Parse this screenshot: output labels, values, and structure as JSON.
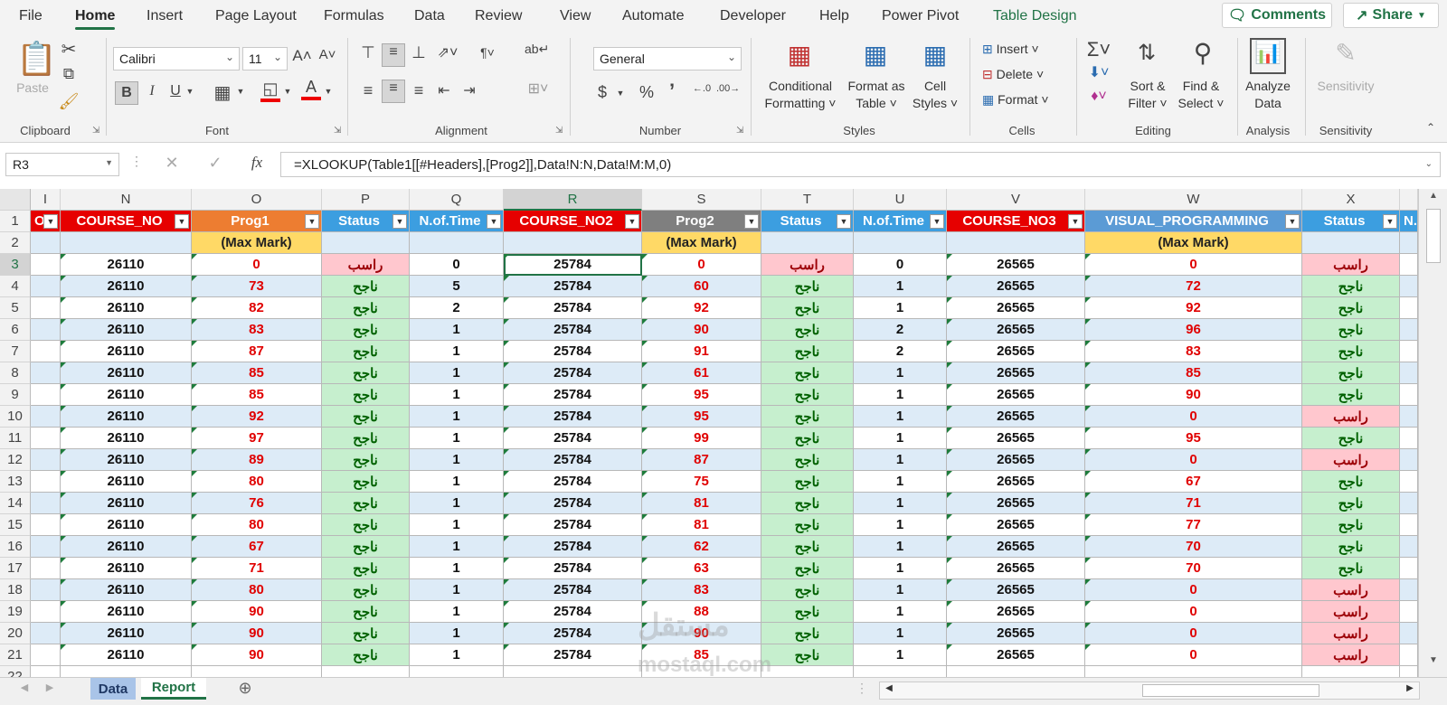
{
  "menu": {
    "tabs": [
      "File",
      "Home",
      "Insert",
      "Page Layout",
      "Formulas",
      "Data",
      "Review",
      "View",
      "Automate",
      "Developer",
      "Help",
      "Power Pivot",
      "Table Design"
    ],
    "comments": "Comments",
    "share": "Share"
  },
  "ribbon": {
    "clipboard": {
      "paste": "Paste",
      "label": "Clipboard"
    },
    "font": {
      "name": "Calibri",
      "size": "11",
      "label": "Font",
      "bold": "B",
      "italic": "I",
      "underline": "U"
    },
    "alignment": {
      "label": "Alignment"
    },
    "number": {
      "format": "General",
      "label": "Number",
      "currency": "$",
      "percent": "%"
    },
    "styles": {
      "conditional": [
        "Conditional",
        "Formatting"
      ],
      "format_table": [
        "Format as",
        "Table"
      ],
      "cell_styles": [
        "Cell",
        "Styles"
      ],
      "label": "Styles"
    },
    "cells": {
      "insert": "Insert",
      "delete": "Delete",
      "format": "Format",
      "label": "Cells"
    },
    "editing": {
      "sort": [
        "Sort &",
        "Filter"
      ],
      "find": [
        "Find &",
        "Select"
      ],
      "label": "Editing"
    },
    "analysis": {
      "analyze": [
        "Analyze",
        "Data"
      ],
      "label": "Analysis"
    },
    "sensitivity": {
      "button": "Sensitivity",
      "label": "Sensitivity"
    }
  },
  "formula_bar": {
    "name_box": "R3",
    "fx": "fx",
    "formula": "=XLOOKUP(Table1[[#Headers],[Prog2]],Data!N:N,Data!M:M,0)"
  },
  "grid": {
    "columns": [
      "I",
      "N",
      "O",
      "P",
      "Q",
      "R",
      "S",
      "T",
      "U",
      "V",
      "W",
      "X",
      ""
    ],
    "selected_column": "R",
    "headers": [
      "OB",
      "COURSE_NO",
      "Prog1",
      "Status",
      "N.of.Time",
      "COURSE_NO2",
      "Prog2",
      "Status",
      "N.of.Time",
      "COURSE_NO3",
      "VISUAL_PROGRAMMING",
      "Status",
      "N.o"
    ],
    "max_mark": "(Max Mark)",
    "rows": [
      {
        "r": "3",
        "n": "26110",
        "o": "0",
        "p": "راسب",
        "q": "0",
        "rr": "25784",
        "s": "0",
        "t": "راسب",
        "u": "0",
        "v": "26565",
        "w": "0",
        "x": "راسب"
      },
      {
        "r": "4",
        "n": "26110",
        "o": "73",
        "p": "ناجح",
        "q": "5",
        "rr": "25784",
        "s": "60",
        "t": "ناجح",
        "u": "1",
        "v": "26565",
        "w": "72",
        "x": "ناجح"
      },
      {
        "r": "5",
        "n": "26110",
        "o": "82",
        "p": "ناجح",
        "q": "2",
        "rr": "25784",
        "s": "92",
        "t": "ناجح",
        "u": "1",
        "v": "26565",
        "w": "92",
        "x": "ناجح"
      },
      {
        "r": "6",
        "n": "26110",
        "o": "83",
        "p": "ناجح",
        "q": "1",
        "rr": "25784",
        "s": "90",
        "t": "ناجح",
        "u": "2",
        "v": "26565",
        "w": "96",
        "x": "ناجح"
      },
      {
        "r": "7",
        "n": "26110",
        "o": "87",
        "p": "ناجح",
        "q": "1",
        "rr": "25784",
        "s": "91",
        "t": "ناجح",
        "u": "2",
        "v": "26565",
        "w": "83",
        "x": "ناجح"
      },
      {
        "r": "8",
        "n": "26110",
        "o": "85",
        "p": "ناجح",
        "q": "1",
        "rr": "25784",
        "s": "61",
        "t": "ناجح",
        "u": "1",
        "v": "26565",
        "w": "85",
        "x": "ناجح"
      },
      {
        "r": "9",
        "n": "26110",
        "o": "85",
        "p": "ناجح",
        "q": "1",
        "rr": "25784",
        "s": "95",
        "t": "ناجح",
        "u": "1",
        "v": "26565",
        "w": "90",
        "x": "ناجح"
      },
      {
        "r": "10",
        "n": "26110",
        "o": "92",
        "p": "ناجح",
        "q": "1",
        "rr": "25784",
        "s": "95",
        "t": "ناجح",
        "u": "1",
        "v": "26565",
        "w": "0",
        "x": "راسب"
      },
      {
        "r": "11",
        "n": "26110",
        "o": "97",
        "p": "ناجح",
        "q": "1",
        "rr": "25784",
        "s": "99",
        "t": "ناجح",
        "u": "1",
        "v": "26565",
        "w": "95",
        "x": "ناجح"
      },
      {
        "r": "12",
        "n": "26110",
        "o": "89",
        "p": "ناجح",
        "q": "1",
        "rr": "25784",
        "s": "87",
        "t": "ناجح",
        "u": "1",
        "v": "26565",
        "w": "0",
        "x": "راسب"
      },
      {
        "r": "13",
        "n": "26110",
        "o": "80",
        "p": "ناجح",
        "q": "1",
        "rr": "25784",
        "s": "75",
        "t": "ناجح",
        "u": "1",
        "v": "26565",
        "w": "67",
        "x": "ناجح"
      },
      {
        "r": "14",
        "n": "26110",
        "o": "76",
        "p": "ناجح",
        "q": "1",
        "rr": "25784",
        "s": "81",
        "t": "ناجح",
        "u": "1",
        "v": "26565",
        "w": "71",
        "x": "ناجح"
      },
      {
        "r": "15",
        "n": "26110",
        "o": "80",
        "p": "ناجح",
        "q": "1",
        "rr": "25784",
        "s": "81",
        "t": "ناجح",
        "u": "1",
        "v": "26565",
        "w": "77",
        "x": "ناجح"
      },
      {
        "r": "16",
        "n": "26110",
        "o": "67",
        "p": "ناجح",
        "q": "1",
        "rr": "25784",
        "s": "62",
        "t": "ناجح",
        "u": "1",
        "v": "26565",
        "w": "70",
        "x": "ناجح"
      },
      {
        "r": "17",
        "n": "26110",
        "o": "71",
        "p": "ناجح",
        "q": "1",
        "rr": "25784",
        "s": "63",
        "t": "ناجح",
        "u": "1",
        "v": "26565",
        "w": "70",
        "x": "ناجح"
      },
      {
        "r": "18",
        "n": "26110",
        "o": "80",
        "p": "ناجح",
        "q": "1",
        "rr": "25784",
        "s": "83",
        "t": "ناجح",
        "u": "1",
        "v": "26565",
        "w": "0",
        "x": "راسب"
      },
      {
        "r": "19",
        "n": "26110",
        "o": "90",
        "p": "ناجح",
        "q": "1",
        "rr": "25784",
        "s": "88",
        "t": "ناجح",
        "u": "1",
        "v": "26565",
        "w": "0",
        "x": "راسب"
      },
      {
        "r": "20",
        "n": "26110",
        "o": "90",
        "p": "ناجح",
        "q": "1",
        "rr": "25784",
        "s": "90",
        "t": "ناجح",
        "u": "1",
        "v": "26565",
        "w": "0",
        "x": "راسب"
      },
      {
        "r": "21",
        "n": "26110",
        "o": "90",
        "p": "ناجح",
        "q": "1",
        "rr": "25784",
        "s": "85",
        "t": "ناجح",
        "u": "1",
        "v": "26565",
        "w": "0",
        "x": "راسب"
      }
    ]
  },
  "sheets": {
    "tabs": [
      "Data",
      "Report"
    ],
    "active": "Report"
  },
  "watermark": {
    "arabic": "مستقل",
    "latin": "mostaql.com"
  },
  "colors": {
    "excel_green": "#217346",
    "header_red": "#e60000",
    "header_orange": "#ed7d31",
    "header_blue": "#3c9ee0",
    "header_gray": "#7f7f7f",
    "header_lightblue": "#5b9bd5",
    "max_mark_yellow": "#ffd966",
    "pass_fill": "#c6efce",
    "pass_text": "#006100",
    "fail_fill": "#ffc7ce",
    "fail_text": "#9c0006",
    "band_fill": "#ddebf7"
  }
}
